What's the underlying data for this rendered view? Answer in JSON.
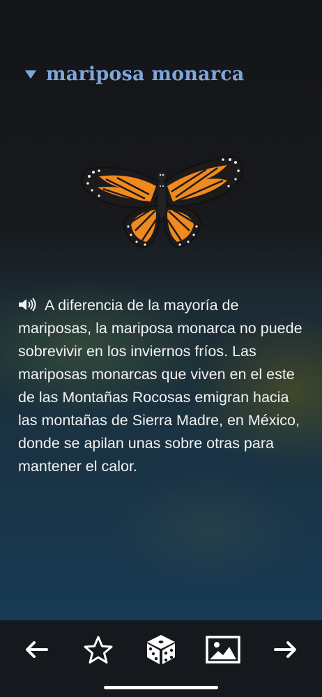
{
  "header": {
    "title": "mariposa monarca",
    "expand_icon": "triangle-down-icon"
  },
  "illustration": {
    "subject": "monarch-butterfly-icon"
  },
  "article": {
    "audio_icon": "speaker-icon",
    "text": "A diferencia de la mayoría de mariposas, la mariposa monarca no puede sobrevivir en los inviernos fríos. Las mariposas monarcas que viven en el este de las Montañas Rocosas emigran hacia las montañas de Sierra Madre, en México, donde se apilan unas sobre otras para mantener el calor."
  },
  "toolbar": {
    "items": [
      {
        "icon": "arrow-left-icon"
      },
      {
        "icon": "star-icon"
      },
      {
        "icon": "dice-icon"
      },
      {
        "icon": "image-icon"
      },
      {
        "icon": "arrow-right-icon"
      }
    ]
  },
  "colors": {
    "accent": "#7fa6dd",
    "text": "#f2f2f2",
    "toolbar_bg": "#15191d",
    "wing_orange": "#f08a1e"
  }
}
